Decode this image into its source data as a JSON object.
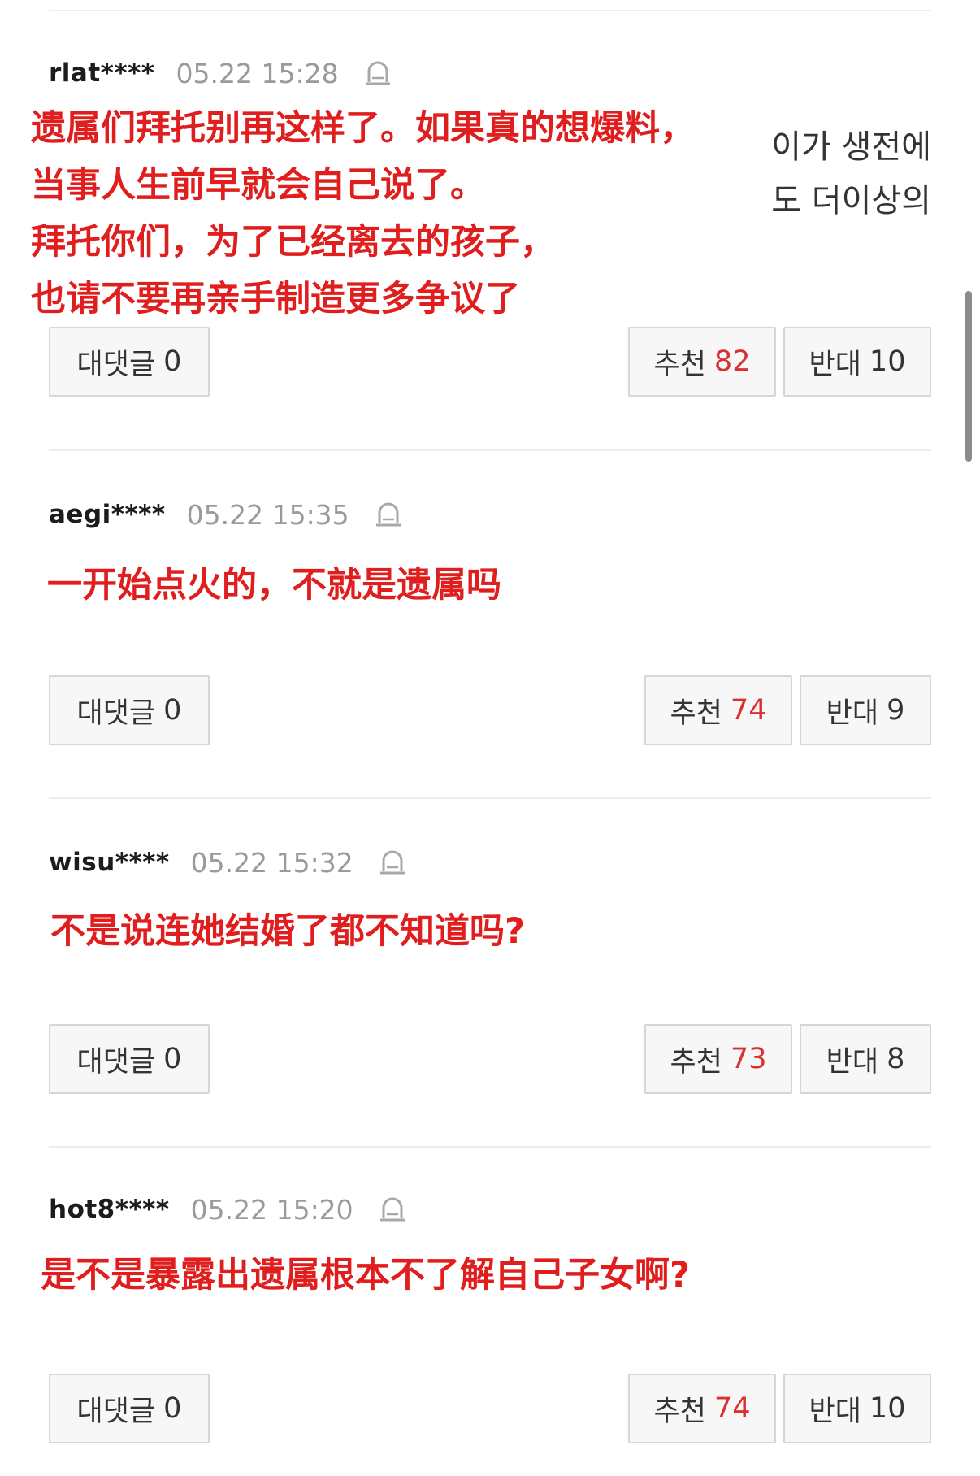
{
  "comments": [
    {
      "username": "rlat****",
      "timestamp": "05.22 15:28",
      "overlay_lines": [
        "遗属们拜托别再这样了。如果真的想爆料，",
        "当事人生前早就会自己说了。",
        "拜托你们，为了已经离去的孩子，",
        "也请不要再亲手制造更多争议了"
      ],
      "partial_original_lines": [
        "이가 생전에",
        "도 더이상의"
      ],
      "reply_label": "대댓글",
      "reply_count": "0",
      "like_label": "추천",
      "like_count": "82",
      "dislike_label": "반대",
      "dislike_count": "10"
    },
    {
      "username": "aegi****",
      "timestamp": "05.22 15:35",
      "overlay_lines": [
        "一开始点火的，不就是遗属吗"
      ],
      "reply_label": "대댓글",
      "reply_count": "0",
      "like_label": "추천",
      "like_count": "74",
      "dislike_label": "반대",
      "dislike_count": "9"
    },
    {
      "username": "wisu****",
      "timestamp": "05.22 15:32",
      "overlay_lines": [
        "不是说连她结婚了都不知道吗?"
      ],
      "reply_label": "대댓글",
      "reply_count": "0",
      "like_label": "추천",
      "like_count": "73",
      "dislike_label": "반대",
      "dislike_count": "8"
    },
    {
      "username": "hot8****",
      "timestamp": "05.22 15:20",
      "overlay_lines": [
        "是不是暴露出遗属根本不了解自己子女啊?"
      ],
      "reply_label": "대댓글",
      "reply_count": "0",
      "like_label": "추천",
      "like_count": "74",
      "dislike_label": "반대",
      "dislike_count": "10"
    }
  ],
  "colors": {
    "overlay_red": "#e01e1e",
    "like_count_red": "#d93030",
    "timestamp_gray": "#9a9a9a"
  },
  "icons": {
    "report": "siren-report-icon"
  }
}
